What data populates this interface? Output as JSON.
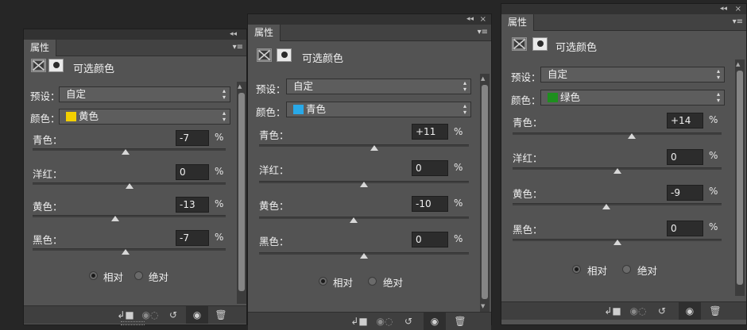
{
  "panels": [
    {
      "tab": "属性",
      "collapse_icon": "◂◂",
      "close_icon": "",
      "menu_icon": "▾≡",
      "title": "可选颜色",
      "preset_label": "预设：",
      "preset_value": "自定",
      "color_label": "颜色：",
      "color_value": "黄色",
      "swatch": "#f3d000",
      "sliders": [
        {
          "label": "青色：",
          "value": "-7",
          "pct": "%",
          "fraction": 0.48
        },
        {
          "label": "洋红：",
          "value": "0",
          "pct": "%",
          "fraction": 0.5
        },
        {
          "label": "黄色：",
          "value": "-13",
          "pct": "%",
          "fraction": 0.43
        },
        {
          "label": "黑色：",
          "value": "-7",
          "pct": "%",
          "fraction": 0.48
        }
      ],
      "radio_relative": "相对",
      "radio_absolute": "绝对"
    },
    {
      "tab": "属性",
      "collapse_icon": "◂◂",
      "close_icon": "×",
      "menu_icon": "▾≡",
      "title": "可选颜色",
      "preset_label": "预设：",
      "preset_value": "自定",
      "color_label": "颜色：",
      "color_value": "青色",
      "swatch": "#29a9e8",
      "sliders": [
        {
          "label": "青色：",
          "value": "+11",
          "pct": "%",
          "fraction": 0.55
        },
        {
          "label": "洋红：",
          "value": "0",
          "pct": "%",
          "fraction": 0.5
        },
        {
          "label": "黄色：",
          "value": "-10",
          "pct": "%",
          "fraction": 0.45
        },
        {
          "label": "黑色：",
          "value": "0",
          "pct": "%",
          "fraction": 0.5
        }
      ],
      "radio_relative": "相对",
      "radio_absolute": "绝对"
    },
    {
      "tab": "属性",
      "collapse_icon": "◂◂",
      "close_icon": "×",
      "menu_icon": "▾≡",
      "title": "可选颜色",
      "preset_label": "预设：",
      "preset_value": "自定",
      "color_label": "颜色：",
      "color_value": "绿色",
      "swatch": "#1e8f1e",
      "sliders": [
        {
          "label": "青色：",
          "value": "+14",
          "pct": "%",
          "fraction": 0.57
        },
        {
          "label": "洋红：",
          "value": "0",
          "pct": "%",
          "fraction": 0.5
        },
        {
          "label": "黄色：",
          "value": "-9",
          "pct": "%",
          "fraction": 0.45
        },
        {
          "label": "黑色：",
          "value": "0",
          "pct": "%",
          "fraction": 0.5
        }
      ],
      "radio_relative": "相对",
      "radio_absolute": "绝对"
    }
  ],
  "footer_icons": [
    "clip-to-layer-icon",
    "view-previous-state-icon",
    "reset-icon",
    "visibility-eye-icon",
    "trash-icon"
  ]
}
